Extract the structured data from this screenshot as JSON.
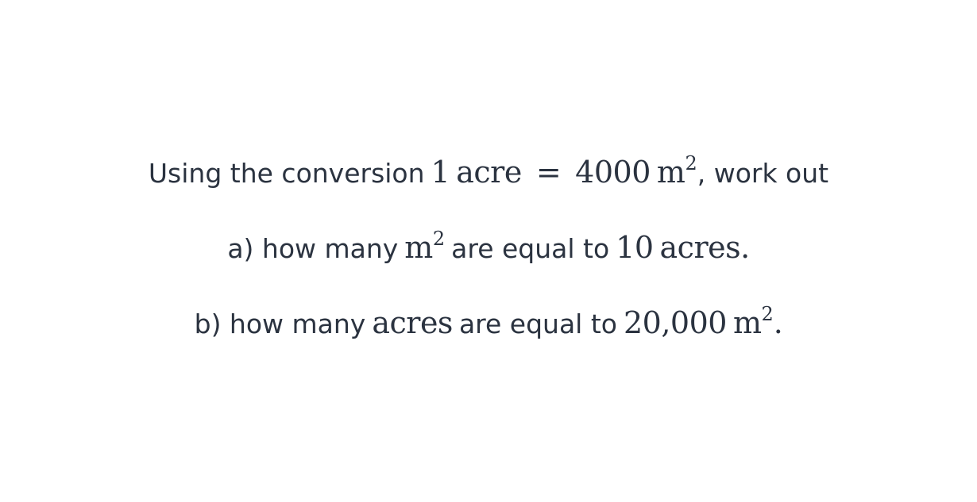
{
  "question": {
    "intro": {
      "text_before": "Using the conversion",
      "math_one": "1",
      "math_acre": "acre",
      "math_equals": "=",
      "math_value": "4000",
      "math_unit": "m",
      "math_exponent": "2",
      "text_after": ", work out"
    },
    "part_a": {
      "text_before": "a) how many",
      "math_unit": "m",
      "math_exponent": "2",
      "text_middle": "are equal to",
      "math_value": "10",
      "math_unit_word": "acres.",
      "text_after": ""
    },
    "part_b": {
      "text_before": "b) how many",
      "math_unit_word": "acres",
      "text_middle": "are equal to",
      "math_value": "20,000",
      "math_unit": "m",
      "math_exponent": "2",
      "text_after": "."
    }
  }
}
